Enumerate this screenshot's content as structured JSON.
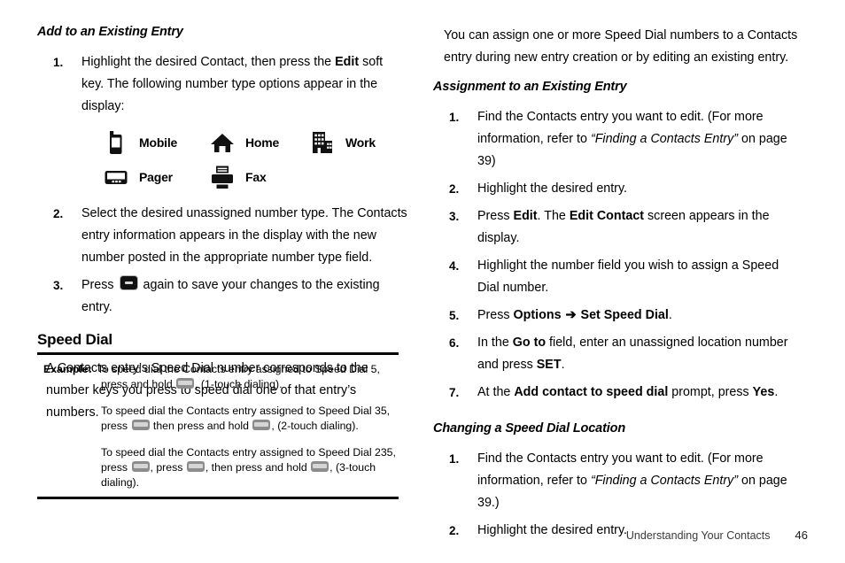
{
  "left_column": {
    "heading": "Add to an Existing Entry",
    "steps_top": [
      {
        "num": "1.",
        "text_before": "Highlight the desired Contact, then press the ",
        "bold": "Edit",
        "text_after": " soft key. The following number type options appear in the display:"
      }
    ],
    "number_types": [
      {
        "icon": "mobile-phone-icon",
        "label": "Mobile"
      },
      {
        "icon": "house-icon",
        "label": "Home"
      },
      {
        "icon": "office-building-icon",
        "label": "Work"
      },
      {
        "icon": "pager-icon",
        "label": "Pager"
      },
      {
        "icon": "fax-machine-icon",
        "label": "Fax"
      }
    ],
    "steps_bottom": [
      {
        "num": "2.",
        "text": "Select the desired unassigned number type. The Contacts entry information appears in the display with the new number posted in the appropriate number type field."
      },
      {
        "num": "3.",
        "text_before": "Press ",
        "icon": "ok-key-icon",
        "text_after": " again to save your changes to the existing entry."
      }
    ],
    "speed_dial_heading": "Speed Dial",
    "speed_dial_para": "A Contacts entry’s Speed Dial number corresponds to the number keys you press to speed dial one of that entry’s numbers.",
    "example": {
      "label": "Example:",
      "line1_a": "To speed dial the Contacts entry assigned to Speed Dial 5, press and hold ",
      "line1_b": ", (1-touch dialing).",
      "line2_a": "To speed dial the Contacts entry assigned to Speed Dial 35, press ",
      "line2_b": " then press and hold ",
      "line2_c": ", (2-touch dialing).",
      "line3_a": "To speed dial the Contacts entry assigned to Speed Dial 235, press ",
      "line3_b": ", press ",
      "line3_c": ", then press and hold ",
      "line3_d": ", (3-touch dialing)."
    }
  },
  "right_column": {
    "intro": "You can assign one or more Speed Dial numbers to a Contacts entry during new entry creation or by editing an existing entry.",
    "assignment_heading": "Assignment to an Existing Entry",
    "assignment_steps": [
      {
        "num": "1.",
        "a": "Find the Contacts entry you want to edit. (For more information, refer to ",
        "italic": "“Finding a Contacts Entry”",
        "b": "  on page 39)"
      },
      {
        "num": "2.",
        "a": "Highlight the desired entry."
      },
      {
        "num": "3.",
        "a": "Press ",
        "bold1": "Edit",
        "b": ". The ",
        "bold2": "Edit Contact",
        "c": " screen appears in the display."
      },
      {
        "num": "4.",
        "a": "Highlight the number field you wish to assign a Speed Dial number."
      },
      {
        "num": "5.",
        "a": "Press ",
        "bold1": "Options",
        "arrow": "➔",
        "bold2": "Set Speed Dial",
        "b": "."
      },
      {
        "num": "6.",
        "a": "In the ",
        "bold1": "Go to",
        "b": " field, enter an unassigned location number and press ",
        "bold2": "SET",
        "c": "."
      },
      {
        "num": "7.",
        "a": "At the ",
        "bold1": "Add contact to speed dial",
        "b": " prompt, press ",
        "bold2": "Yes",
        "c": "."
      }
    ],
    "changing_heading": "Changing a Speed Dial Location",
    "changing_steps": [
      {
        "num": "1.",
        "a": "Find the Contacts entry you want to edit. (For more information, refer to ",
        "italic": "“Finding a Contacts Entry”",
        "b": "  on page 39.)"
      },
      {
        "num": "2.",
        "a": "Highlight the desired entry."
      }
    ]
  },
  "footer": {
    "section": "Understanding Your Contacts",
    "page": "46"
  }
}
